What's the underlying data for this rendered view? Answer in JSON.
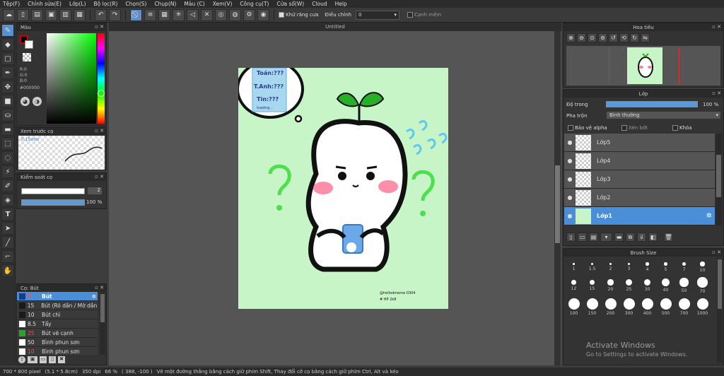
{
  "menu": [
    "Tệp(F)",
    "Chỉnh sửa(E)",
    "Lớp(L)",
    "Bộ lọc(R)",
    "Chọn(S)",
    "Chụp(N)",
    "Màu (C)",
    "Xem(V)",
    "Công cụ(T)",
    "Cửa sổ(W)",
    "Cloud",
    "Help"
  ],
  "toolbar": {
    "antialias_label": "Khử răng cưa",
    "adjust_label": "Điều chỉnh",
    "adjust_value": "0",
    "snap_label": "Cạnh mềm"
  },
  "color_panel": {
    "title": "Màu",
    "r": "R:0",
    "g": "G:0",
    "b": "B:0",
    "hex": "#000000"
  },
  "brush_preview": {
    "title": "Xem trước cọ",
    "size": "0.15mm"
  },
  "brush_control": {
    "title": "Kiểm soát cọ",
    "size_value": "2",
    "opacity_value": "100 %"
  },
  "brush_list": {
    "title": "Cọ: Bút",
    "items": [
      {
        "size": "9",
        "name": "Bút",
        "color": "#1a3a8c",
        "sel": true
      },
      {
        "size": "15",
        "name": "Bút (Rõ dần / Mờ dần)",
        "color": "#1a1a1a",
        "sel": false
      },
      {
        "size": "10",
        "name": "Bút chì",
        "color": "#1a1a1a",
        "sel": false
      },
      {
        "size": "8.5",
        "name": "Tẩy",
        "color": "#ffffff",
        "sel": false
      },
      {
        "size": "25",
        "name": "Bút vẽ cạnh",
        "color": "#22aa22",
        "sel": false
      },
      {
        "size": "50",
        "name": "Bình phun sơn",
        "color": "#ffffff",
        "sel": false
      },
      {
        "size": "10",
        "name": "Bình phun sơn",
        "color": "#ffffff",
        "sel": false
      }
    ]
  },
  "canvas": {
    "tab": "Untitled"
  },
  "artwork": {
    "bubble_lines": [
      "Toán:???",
      "T.Anh:???",
      "Tin:???",
      "loading..."
    ],
    "credit_line1": "@hellodmeme 0304",
    "credit_line2": "# HP 2k8"
  },
  "navigator": {
    "title": "Hoa tiêu"
  },
  "layer_panel": {
    "title": "Lớp",
    "opacity_label": "Độ trong",
    "opacity_value": "100 %",
    "blend_label": "Pha trộn",
    "blend_value": "Bình thường",
    "protect_alpha": "Bảo vệ alpha",
    "clipping": "Xén bớt",
    "lock": "Khóa",
    "layers": [
      {
        "name": "Lớp5",
        "sel": false
      },
      {
        "name": "Lớp4",
        "sel": false
      },
      {
        "name": "Lớp3",
        "sel": false
      },
      {
        "name": "Lớp2",
        "sel": false
      },
      {
        "name": "Lớp1",
        "sel": true
      }
    ]
  },
  "brush_size": {
    "title": "Brush Size",
    "sizes": [
      "1",
      "1.5",
      "2",
      "3",
      "4",
      "5",
      "7",
      "10",
      "12",
      "15",
      "20",
      "25",
      "30",
      "40",
      "50",
      "70",
      "100",
      "150",
      "200",
      "300",
      "400",
      "500",
      "700",
      "1000"
    ]
  },
  "status": {
    "dims": "700 * 800 pixel",
    "size_cm": "(5.1 * 5.8cm)",
    "dpi": "350 dpi",
    "zoom": "66 %",
    "coords": "( 388, -100 )",
    "hint": "Vẽ một đường thẳng bằng cách giữ phím Shift, Thay đổi cỡ cọ bằng cách giữ phím Ctrl, Alt và kéo"
  },
  "watermark": {
    "line1": "Activate Windows",
    "line2": "Go to Settings to activate Windows."
  },
  "colors": {
    "accent": "#4a8ed8",
    "canvas_bg": "#c8f5c8"
  }
}
